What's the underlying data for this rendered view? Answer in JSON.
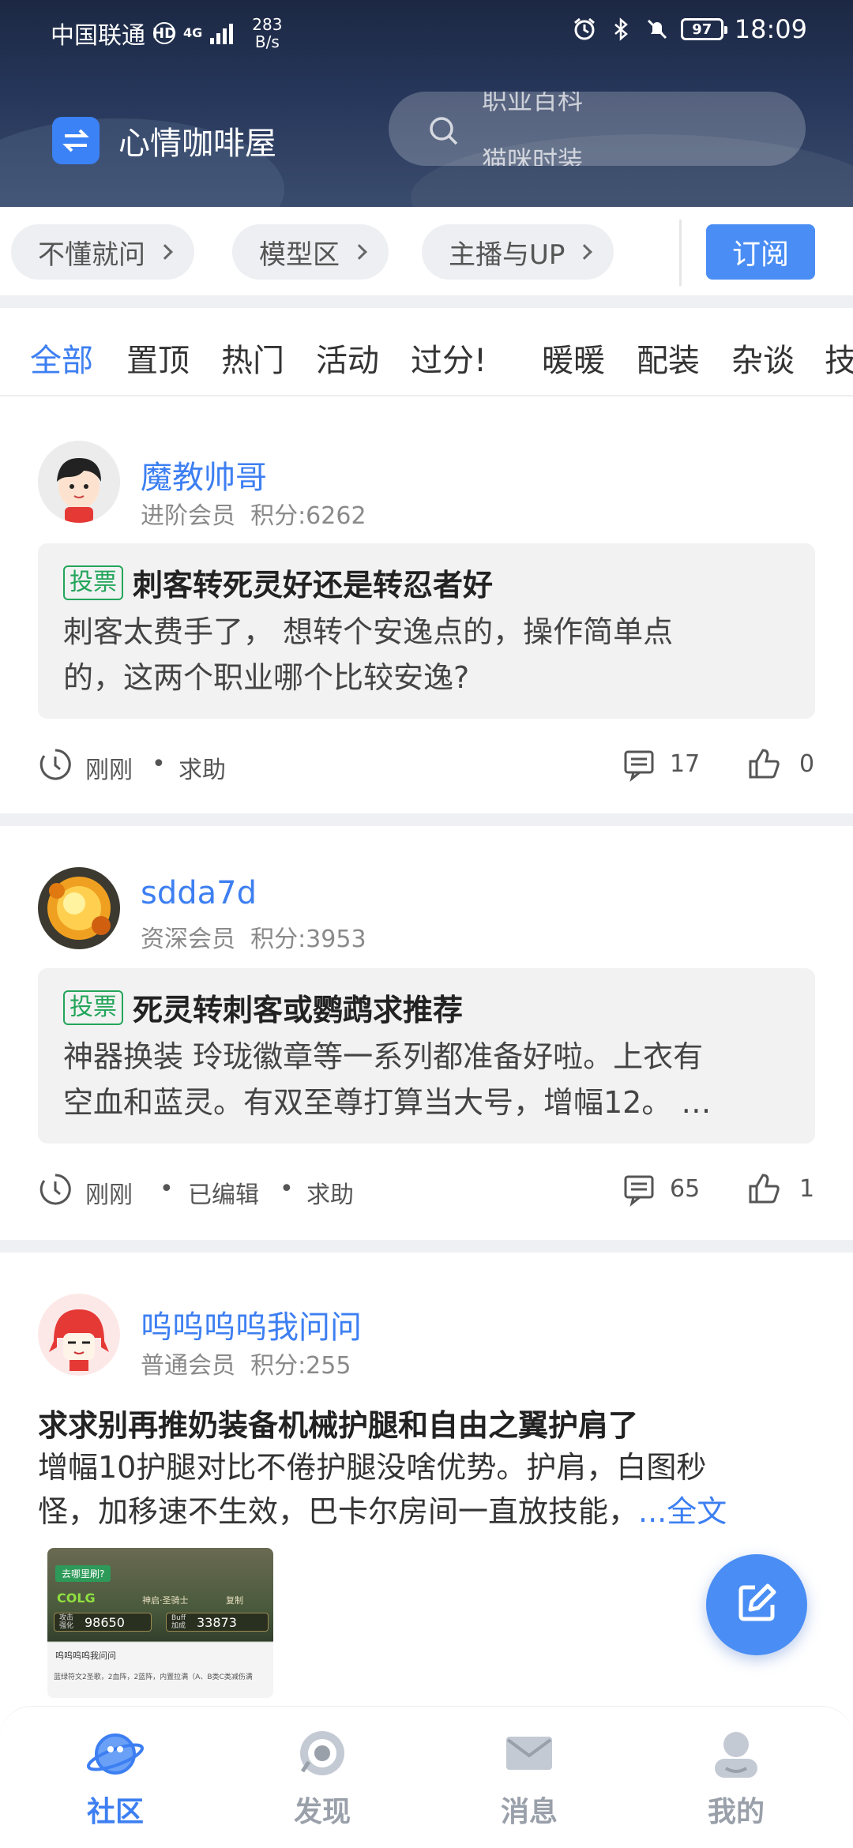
{
  "status_bar": {
    "carrier": "中国联通",
    "hd": "HD",
    "network": "4G",
    "speed_value": "283",
    "speed_unit": "B/s",
    "battery": "97",
    "time": "18:09"
  },
  "header": {
    "app_title": "心情咖啡屋",
    "search_hints": [
      "职业百科",
      "猫咪时装"
    ]
  },
  "chips": {
    "items": [
      "不懂就问",
      "模型区",
      "主播与UP"
    ],
    "subscribe_label": "订阅"
  },
  "tabs": {
    "items": [
      "全部",
      "置顶",
      "热门",
      "活动",
      "过分!",
      "暖暖",
      "配装",
      "杂谈",
      "技"
    ],
    "active_index": 0
  },
  "posts": [
    {
      "username": "魔教帅哥",
      "member_level": "进阶会员",
      "points": "积分:6262",
      "tag": "投票",
      "title": "刺客转死灵好还是转忍者好",
      "body_line1": "刺客太费手了， 想转个安逸点的，操作简单点",
      "body_line2": "的，这两个职业哪个比较安逸?",
      "time": "刚刚",
      "dot": "•",
      "category": "求助",
      "comments": "17",
      "likes": "0"
    },
    {
      "username": "sdda7d",
      "member_level": "资深会员",
      "points": "积分:3953",
      "tag": "投票",
      "title": "死灵转刺客或鹦鹉求推荐",
      "body_line1": " 神器换装 玲珑徽章等一系列都准备好啦。上衣有",
      "body_line2": "空血和蓝灵。有双至尊打算当大号，增幅12。 …",
      "time": "刚刚",
      "dot": "•",
      "edited": "已编辑",
      "category": "求助",
      "comments": "65",
      "likes": "1"
    },
    {
      "username": "呜呜呜呜我问问",
      "member_level": "普通会员",
      "points": "积分:255",
      "title": "求求别再推奶装备机械护腿和自由之翼护肩了",
      "body_line1": "增幅10护腿对比不倦护腿没啥优势。护肩，白图秒",
      "body_line2": "怪，加移速不生效，巴卡尔房间一直放技能，",
      "more_label": "...全文",
      "thumb": {
        "bubble": "去哪里刷?",
        "brand": "COLG",
        "class_name": "神启·圣骑士",
        "copy_label": "复制",
        "attack_label": "攻击强化",
        "attack_value": "98650",
        "buff_label": "Buff加成",
        "buff_value": "33873",
        "quote_user": "呜呜呜呜我问问",
        "quote_text": "蓝绿符文2圣歌，2血阵，2蓝阵，内置拉满（A、B类C类减伤满"
      }
    }
  ],
  "bottom_nav": {
    "items": [
      "社区",
      "发现",
      "消息",
      "我的"
    ],
    "active_index": 0
  },
  "colors": {
    "accent": "#3d7ff2",
    "vote_green": "#23a55a",
    "header_dark": "#1c2843"
  },
  "icons": {
    "fab": "edit-icon",
    "search": "search-icon",
    "logo": "swap-arrows-icon"
  }
}
